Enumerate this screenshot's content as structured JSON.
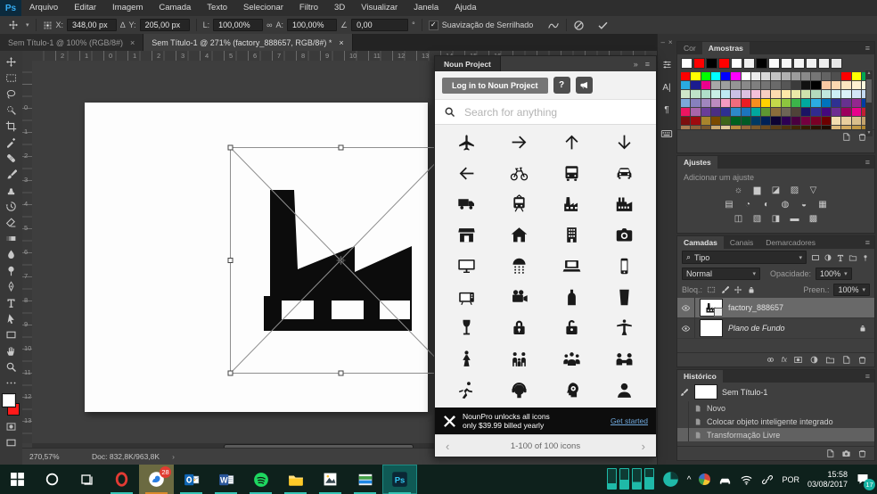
{
  "menubar": {
    "logo": "Ps",
    "items": [
      "Arquivo",
      "Editar",
      "Imagem",
      "Camada",
      "Texto",
      "Selecionar",
      "Filtro",
      "3D",
      "Visualizar",
      "Janela",
      "Ajuda"
    ]
  },
  "optionsbar": {
    "x_label": "X:",
    "x_value": "348,00 px",
    "delta_glyph": "∆",
    "y_label": "Y:",
    "y_value": "205,00 px",
    "w_label": "L:",
    "w_value": "100,00%",
    "link_glyph": "∞",
    "h_label": "A:",
    "h_value": "100,00%",
    "angle_glyph": "∠",
    "angle_value": "0,00",
    "degree_glyph": "°",
    "check_glyph": "✓",
    "antialias_label": "Suavização de Serrilhado"
  },
  "doc_tabs": [
    {
      "label": "Sem Título-1 @ 100% (RGB/8#)",
      "close": "×",
      "active": false
    },
    {
      "label": "Sem Título-1 @ 271% (factory_888657, RGB/8#) *",
      "close": "×",
      "active": true
    }
  ],
  "rulers": {
    "top": [
      "2",
      "1",
      "0",
      "1",
      "2",
      "3",
      "4",
      "5",
      "6",
      "7",
      "8",
      "9",
      "10",
      "11",
      "12",
      "13",
      "14",
      "15",
      "16"
    ],
    "left": [
      "0",
      "1",
      "2",
      "3",
      "4",
      "5",
      "6",
      "7",
      "8",
      "9",
      "10",
      "11",
      "12",
      "13"
    ]
  },
  "toolbar": {
    "tools": [
      "move",
      "marquee",
      "lasso",
      "quick-select",
      "crop",
      "eyedropper",
      "healing",
      "brush",
      "clone-stamp",
      "history-brush",
      "eraser",
      "gradient",
      "blur",
      "dodge",
      "pen",
      "type",
      "path-select",
      "shape",
      "hand",
      "zoom-tool",
      "ellipsis"
    ],
    "foreground_color": "#ffffff",
    "background_color": "#ff1a1a"
  },
  "noun_panel": {
    "title": "Noun Project",
    "collapse_glyph": "»",
    "menu_glyph": "≡",
    "login_button": "Log in to Noun Project",
    "help_glyph": "?",
    "search_placeholder": "Search for anything",
    "icons": [
      "airplane",
      "arrow-right",
      "arrow-up",
      "arrow-down",
      "arrow-left",
      "bicycle",
      "bus",
      "car",
      "truck",
      "tram",
      "factory",
      "factory-alt",
      "store",
      "home",
      "building",
      "camera",
      "monitor",
      "shower",
      "laptop",
      "smartphone",
      "tv",
      "video-camera",
      "bottle",
      "pint-glass",
      "wine-glass",
      "lock",
      "unlock",
      "statue",
      "dancer",
      "family",
      "meeting",
      "handshake",
      "runner",
      "headphones",
      "thinking-head",
      "user"
    ],
    "promo_line1": "NounPro unlocks all icons",
    "promo_line2": "only $39.99 billed yearly",
    "promo_cta": "Get started",
    "pager_prev": "‹",
    "pager_label": "1-100 of 100 icons",
    "pager_next": "›"
  },
  "dock": {
    "minimize_glyph": "–",
    "close_glyph": "×",
    "char_glyph": "A|",
    "paragraph_glyph": "¶"
  },
  "swatches_panel": {
    "tab_cor": "Cor",
    "tab_amostras": "Amostras",
    "menu_glyph": "≡",
    "recent": [
      "#ffffff",
      "#ff0000",
      "#000000",
      "#ff0000",
      "#ffffff",
      "#f0f0f0",
      "#000000",
      "#fcfcfc",
      "#f8f8f8",
      "#f4f4f4",
      "#f0f0f0",
      "#ececec",
      "#e8e8e8"
    ],
    "rows": [
      [
        "#ff0000",
        "#ffff00",
        "#00ff00",
        "#00ffff",
        "#0000ff",
        "#ff00ff",
        "#ffffff",
        "#ebebeb",
        "#d8d8d8",
        "#c4c4c4",
        "#b1b1b1",
        "#9d9d9d",
        "#8a8a8a",
        "#767676",
        "#636363",
        "#4f4f4f",
        "#ff0000",
        "#ffff00",
        "#00a651"
      ],
      [
        "#29abe2",
        "#1b1b8f",
        "#ec008c",
        "#a8a8a8",
        "#9e9e9e",
        "#949494",
        "#898989",
        "#7f7f7f",
        "#747474",
        "#6a6a6a",
        "#565656",
        "#3b3b3b",
        "#111111",
        "#000000",
        "#f9c9a3",
        "#fbd7b0",
        "#fde5c0",
        "#fff1d0",
        "#fff8dc"
      ],
      [
        "#cfe8c9",
        "#bfe3c8",
        "#b0dfc9",
        "#c8f0e6",
        "#bfe9f2",
        "#cbc0e4",
        "#dcc0e0",
        "#f3c0d8",
        "#f8cfc0",
        "#fcdcb0",
        "#ffe9a8",
        "#eaeaa8",
        "#cfe3ad",
        "#b5dabc",
        "#c0e8de",
        "#cdeff5",
        "#dbf2f8",
        "#d4e6f7",
        "#c4d9f0"
      ],
      [
        "#7da7d9",
        "#8781bd",
        "#a186be",
        "#bc8cbf",
        "#f49ac1",
        "#f26c7d",
        "#ed1c24",
        "#f68e1f",
        "#ffd200",
        "#c5da4a",
        "#8dc63f",
        "#3cb54a",
        "#00a99e",
        "#2bace2",
        "#0072bc",
        "#2f3192",
        "#67318f",
        "#93278f",
        "#003da5"
      ],
      [
        "#ec1561",
        "#a965aa",
        "#6a3d98",
        "#4b2e83",
        "#2e3092",
        "#2d89c8",
        "#1c75bc",
        "#00a79e",
        "#5d9732",
        "#8a6d3b",
        "#6d6556",
        "#4f4338",
        "#1b1464",
        "#312b8e",
        "#45087d",
        "#6e2d91",
        "#9c005d",
        "#e8018c",
        "#c22033"
      ],
      [
        "#7c0f0f",
        "#9e0b0f",
        "#a8842c",
        "#7a4a00",
        "#3f661a",
        "#00601f",
        "#005a26",
        "#003a63",
        "#002157",
        "#0d0333",
        "#2d0053",
        "#49003f",
        "#75003f",
        "#7a0026",
        "#6d0000",
        "#f3ddb0",
        "#e8cf9e",
        "#d9bf8c",
        "#c3a26b"
      ],
      [
        "#a97c52",
        "#8c6239",
        "#77562e",
        "#c9a86e",
        "#e0c998",
        "#b78b3e",
        "#95683a",
        "#7c5a2b",
        "#6b4a1f",
        "#5c3d15",
        "#4e310c",
        "#412605",
        "#351c00",
        "#2a1300",
        "#200c00",
        "#ddb97a",
        "#cfa95f",
        "#bf9845",
        "#ae862e"
      ]
    ]
  },
  "adjustments_panel": {
    "title": "Ajustes",
    "menu_glyph": "≡",
    "subtitle": "Adicionar um ajuste",
    "rows": [
      [
        "brightness-contrast",
        "levels",
        "curves",
        "exposure",
        "vibrance"
      ],
      [
        "hue-saturation",
        "color-balance",
        "black-white",
        "photo-filter",
        "channel-mixer",
        "color-lookup"
      ],
      [
        "invert",
        "posterize",
        "threshold",
        "gradient-map",
        "selective-color"
      ]
    ],
    "glyphs": {
      "brightness-contrast": "☼",
      "levels": "▆",
      "curves": "◪",
      "exposure": "▨",
      "vibrance": "▽",
      "hue-saturation": "▤",
      "color-balance": "◔",
      "black-white": "◐",
      "photo-filter": "◍",
      "channel-mixer": "◒",
      "color-lookup": "▦",
      "invert": "◫",
      "posterize": "▧",
      "threshold": "◨",
      "gradient-map": "▬",
      "selective-color": "▩"
    }
  },
  "layers_panel": {
    "tabs": [
      "Camadas",
      "Canais",
      "Demarcadores"
    ],
    "active_tab": "Camadas",
    "menu_glyph": "≡",
    "filter_label": "Tipo",
    "search_glyph": "⌕",
    "blend_mode": "Normal",
    "opacity_label": "Opacidade:",
    "opacity_value": "100%",
    "lock_label": "Bloq.:",
    "fill_label": "Preen.:",
    "fill_value": "100%",
    "fx_label": "fx",
    "layers": [
      {
        "name": "factory_888657",
        "selected": true,
        "smart_object": true
      },
      {
        "name": "Plano de Fundo",
        "selected": false,
        "italic": true,
        "locked": true
      }
    ]
  },
  "history_panel": {
    "title": "Histórico",
    "menu_glyph": "≡",
    "snapshot": "Sem Título-1",
    "items": [
      {
        "label": "Novo",
        "selected": false
      },
      {
        "label": "Colocar objeto inteligente integrado",
        "selected": false
      },
      {
        "label": "Transformação Livre",
        "selected": true
      }
    ]
  },
  "statusbar": {
    "zoom": "270,57%",
    "doc": "Doc: 832,8K/963,8K",
    "arrow_glyph": "›"
  },
  "taskbar": {
    "apps": [
      {
        "name": "start",
        "underline": false
      },
      {
        "name": "cortana",
        "underline": false
      },
      {
        "name": "task-view",
        "underline": false
      },
      {
        "name": "opera",
        "underline": true
      },
      {
        "name": "bird",
        "underline": true,
        "highlight": "olive",
        "badge": "28"
      },
      {
        "name": "outlook",
        "underline": true
      },
      {
        "name": "word",
        "underline": true
      },
      {
        "name": "spotify",
        "underline": true
      },
      {
        "name": "explorer",
        "underline": true
      },
      {
        "name": "photos",
        "underline": true
      },
      {
        "name": "pictures",
        "underline": true
      },
      {
        "name": "photoshop",
        "underline": true,
        "highlight": "ps"
      }
    ],
    "tray": {
      "chevron_glyph": "^",
      "language": "POR",
      "time": "15:58",
      "date": "03/08/2017",
      "notif_badge": "17"
    }
  }
}
